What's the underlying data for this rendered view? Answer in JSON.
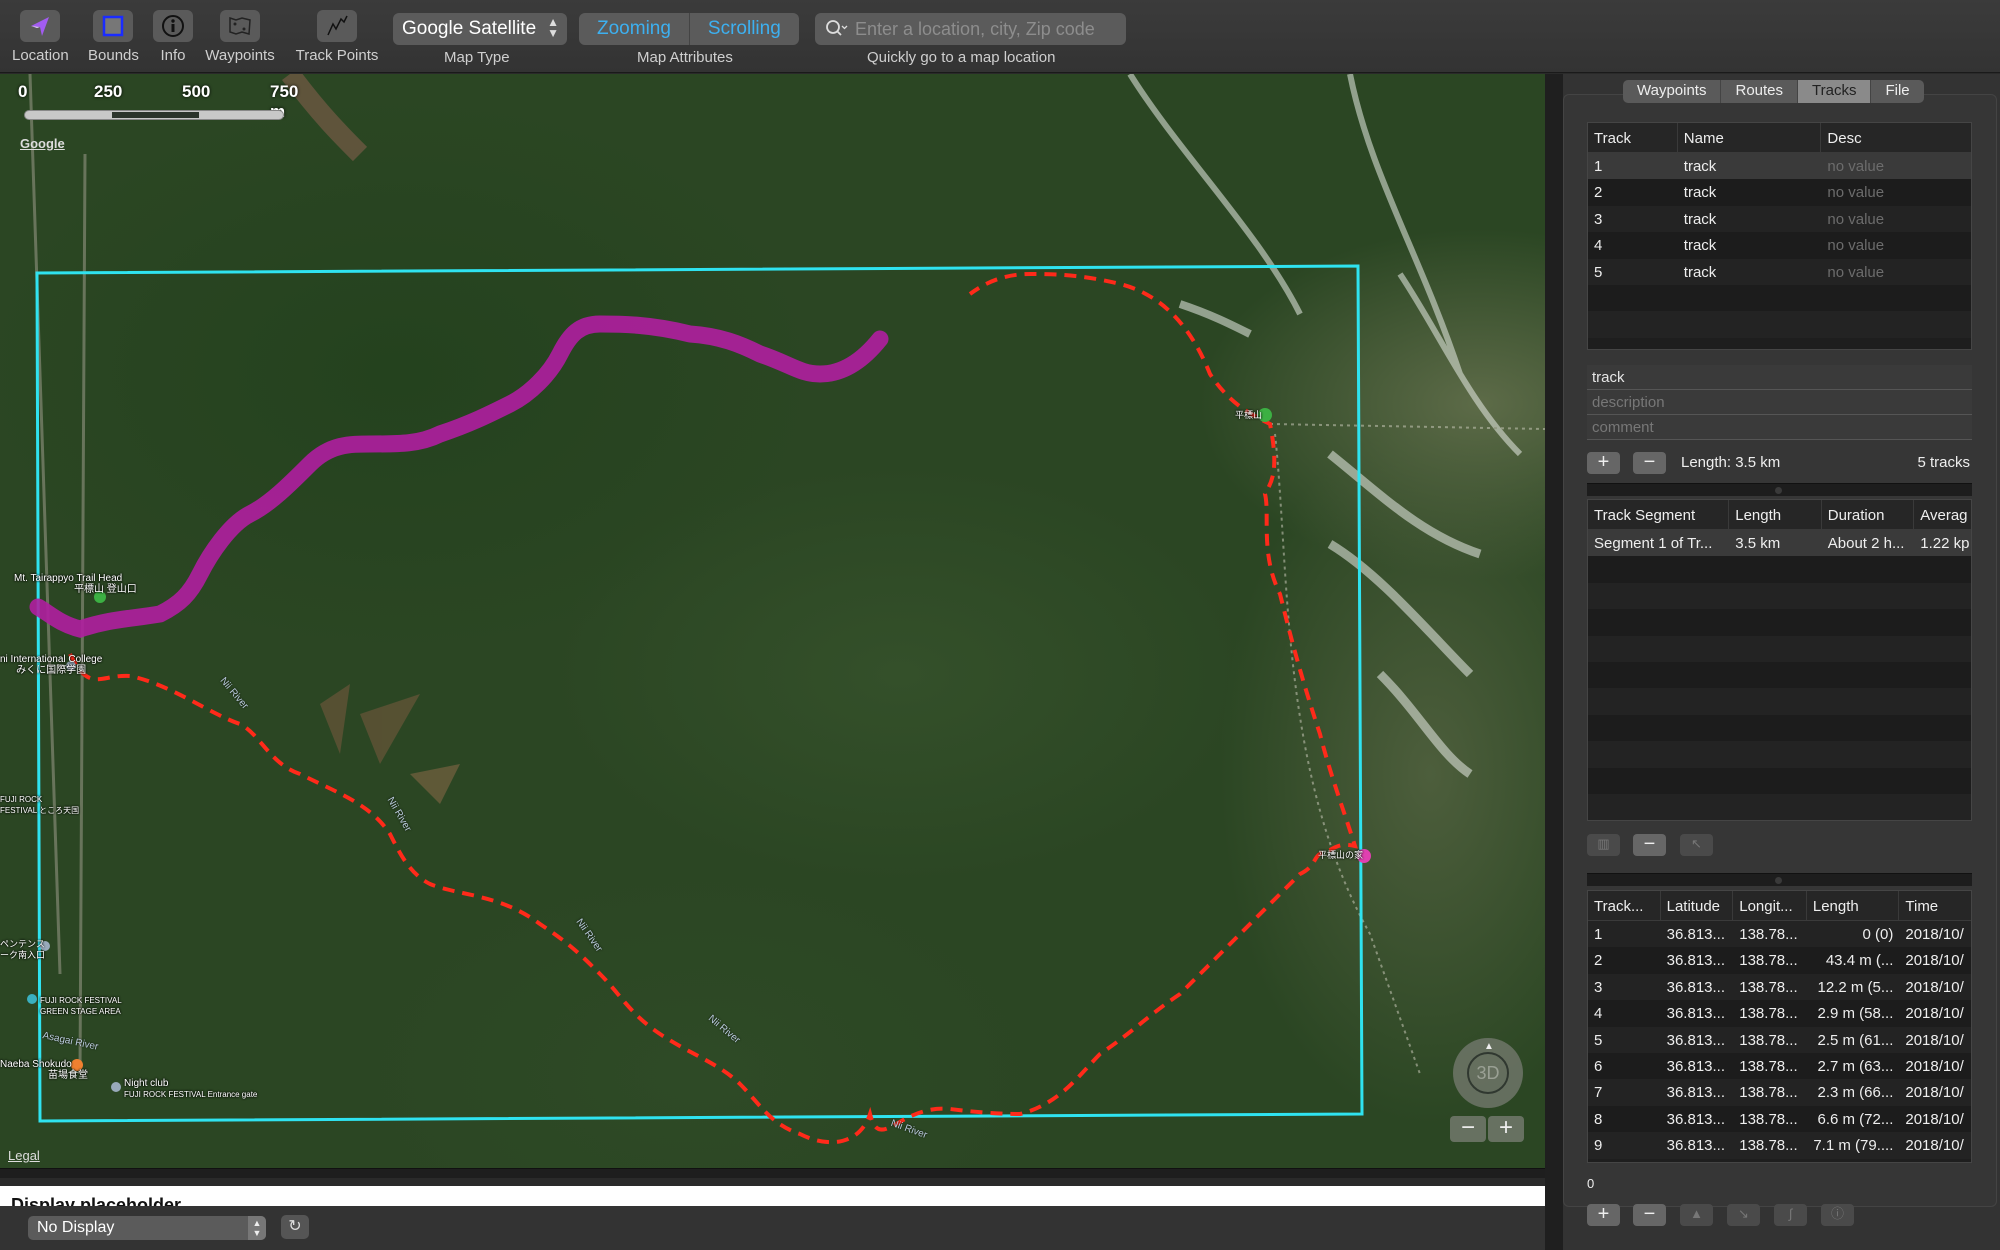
{
  "toolbar": {
    "items": [
      {
        "label": "Location",
        "icon": "location-arrow-icon"
      },
      {
        "label": "Bounds",
        "icon": "bounds-icon"
      },
      {
        "label": "Info",
        "icon": "info-icon"
      },
      {
        "label": "Waypoints",
        "icon": "waypoints-map-icon"
      },
      {
        "label": "Track Points",
        "icon": "track-points-icon"
      }
    ],
    "map_type": {
      "value": "Google Satellite",
      "label": "Map Type"
    },
    "map_attributes": {
      "options": [
        "Zooming",
        "Scrolling"
      ],
      "label": "Map Attributes"
    },
    "search": {
      "placeholder": "Enter a location, city, Zip code",
      "label": "Quickly go to a map location"
    }
  },
  "map": {
    "scale": [
      "0",
      "250",
      "500",
      "750 m"
    ],
    "attribution": "Google",
    "legal": "Legal",
    "labels": [
      {
        "text": "Mt. Tairappyo Trail Head",
        "sub": "平標山 登山口"
      },
      {
        "text": "ni International College",
        "sub": "みくに国際学園"
      },
      {
        "text": "FUJI ROCK FESTIVAL",
        "sub": "GREEN STAGE AREA"
      },
      {
        "text": "Naeba Shokudo",
        "sub": "苗場食堂"
      },
      {
        "text": "Night club",
        "sub": "FUJI ROCK FESTIVAL Entrance gate"
      },
      {
        "text": "FUJI ROCK",
        "sub": "FESTIVAL ところ天国"
      },
      {
        "text": "ペンテンス",
        "sub": "ーク南入口"
      },
      {
        "text": "平標山の家",
        "sub": ""
      },
      {
        "text": "平標山",
        "sub": ""
      }
    ],
    "rivers": [
      "Nii River",
      "Nii River",
      "Nii River",
      "Nii River",
      "Nii River",
      "Asagai River"
    ],
    "nav_3d": "3D",
    "zoom_out": "−",
    "zoom_in": "+",
    "colors": {
      "bounds": "#2fe3f0",
      "track": "#b01ea0",
      "route": "#ff2a1a"
    }
  },
  "bottom": {
    "placeholder_heading": "Display placeholder",
    "display_select": "No Display",
    "refresh_icon": "↻"
  },
  "panel": {
    "tabs": [
      "Waypoints",
      "Routes",
      "Tracks",
      "File"
    ],
    "active_tab": "Tracks",
    "tracks_table": {
      "columns": [
        "Track",
        "Name",
        "Desc"
      ],
      "rows": [
        [
          "1",
          "track",
          "no value"
        ],
        [
          "2",
          "track",
          "no value"
        ],
        [
          "3",
          "track",
          "no value"
        ],
        [
          "4",
          "track",
          "no value"
        ],
        [
          "5",
          "track",
          "no value"
        ]
      ]
    },
    "fields": {
      "name": "track",
      "description_placeholder": "description",
      "comment_placeholder": "comment"
    },
    "length_text": "Length: 3.5 km",
    "count_text": "5 tracks",
    "segments_table": {
      "columns": [
        "Track Segment",
        "Length",
        "Duration",
        "Averag"
      ],
      "rows": [
        [
          "Segment 1 of Tr...",
          "3.5 km",
          "About 2 h...",
          "1.22 kp"
        ]
      ]
    },
    "points_table": {
      "columns": [
        "Track...",
        "Latitude",
        "Longit...",
        "Length",
        "Time"
      ],
      "rows": [
        [
          "1",
          "36.813...",
          "138.78...",
          "0 (0)",
          "2018/10/"
        ],
        [
          "2",
          "36.813...",
          "138.78...",
          "43.4 m (...",
          "2018/10/"
        ],
        [
          "3",
          "36.813...",
          "138.78...",
          "12.2 m (5...",
          "2018/10/"
        ],
        [
          "4",
          "36.813...",
          "138.78...",
          "2.9 m (58...",
          "2018/10/"
        ],
        [
          "5",
          "36.813...",
          "138.78...",
          "2.5 m (61...",
          "2018/10/"
        ],
        [
          "6",
          "36.813...",
          "138.78...",
          "2.7 m (63...",
          "2018/10/"
        ],
        [
          "7",
          "36.813...",
          "138.78...",
          "2.3 m (66...",
          "2018/10/"
        ],
        [
          "8",
          "36.813...",
          "138.78...",
          "6.6 m (72...",
          "2018/10/"
        ],
        [
          "9",
          "36.813...",
          "138.78...",
          "7.1 m (79....",
          "2018/10/"
        ]
      ]
    },
    "points_count": "0"
  }
}
